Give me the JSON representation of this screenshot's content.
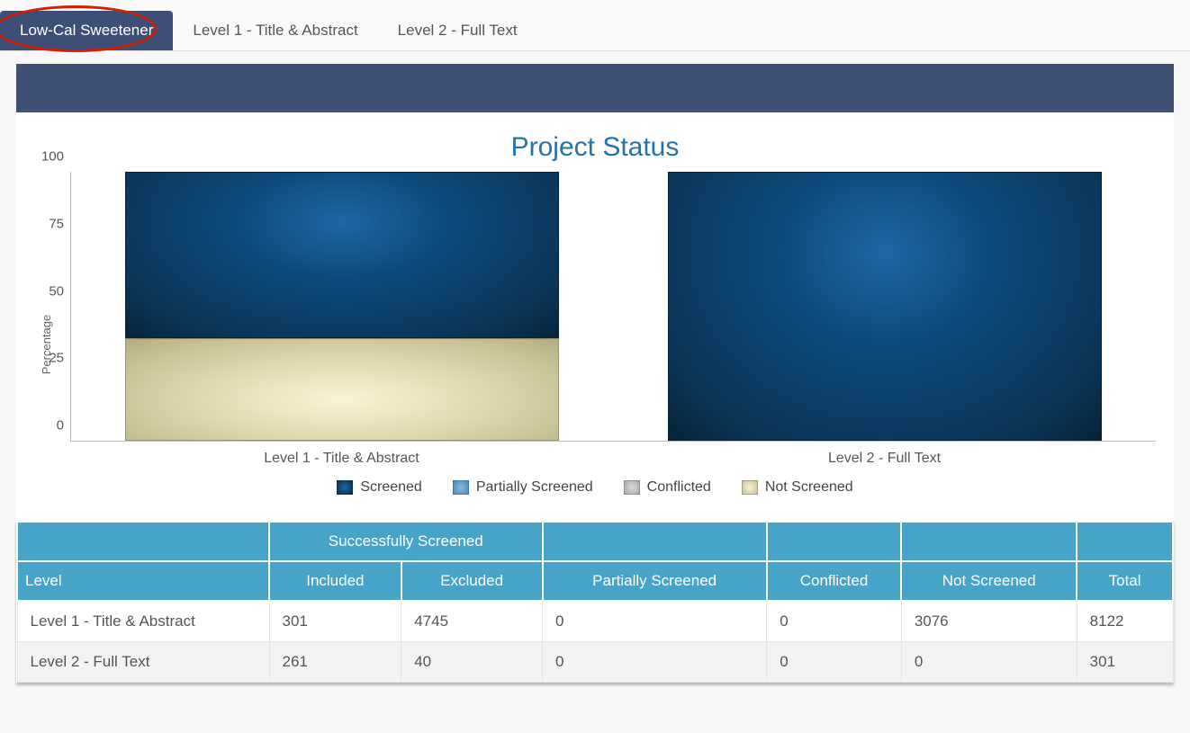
{
  "tabs": {
    "items": [
      {
        "label": "Low-Cal Sweetener",
        "active": true
      },
      {
        "label": "Level 1 - Title & Abstract",
        "active": false
      },
      {
        "label": "Level 2 - Full Text",
        "active": false
      }
    ]
  },
  "title": "Project Status",
  "chart_data": {
    "type": "bar",
    "ylabel": "Percentage",
    "ylim": [
      0,
      100
    ],
    "ticks": [
      0,
      25,
      50,
      75,
      100
    ],
    "categories": [
      "Level 1 - Title & Abstract",
      "Level 2 - Full Text"
    ],
    "series": [
      {
        "name": "Screened",
        "values": [
          62,
          100
        ]
      },
      {
        "name": "Partially Screened",
        "values": [
          0,
          0
        ]
      },
      {
        "name": "Conflicted",
        "values": [
          0,
          0
        ]
      },
      {
        "name": "Not Screened",
        "values": [
          38,
          0
        ]
      }
    ],
    "legend": [
      "Screened",
      "Partially Screened",
      "Conflicted",
      "Not Screened"
    ]
  },
  "table": {
    "group_header": "Successfully Screened",
    "columns": [
      "Level",
      "Included",
      "Excluded",
      "Partially Screened",
      "Conflicted",
      "Not Screened",
      "Total"
    ],
    "rows": [
      {
        "level": "Level 1 - Title & Abstract",
        "included": "301",
        "excluded": "4745",
        "partial": "0",
        "conflicted": "0",
        "not_screened": "3076",
        "total": "8122"
      },
      {
        "level": "Level 2 - Full Text",
        "included": "261",
        "excluded": "40",
        "partial": "0",
        "conflicted": "0",
        "not_screened": "0",
        "total": "301"
      }
    ]
  }
}
